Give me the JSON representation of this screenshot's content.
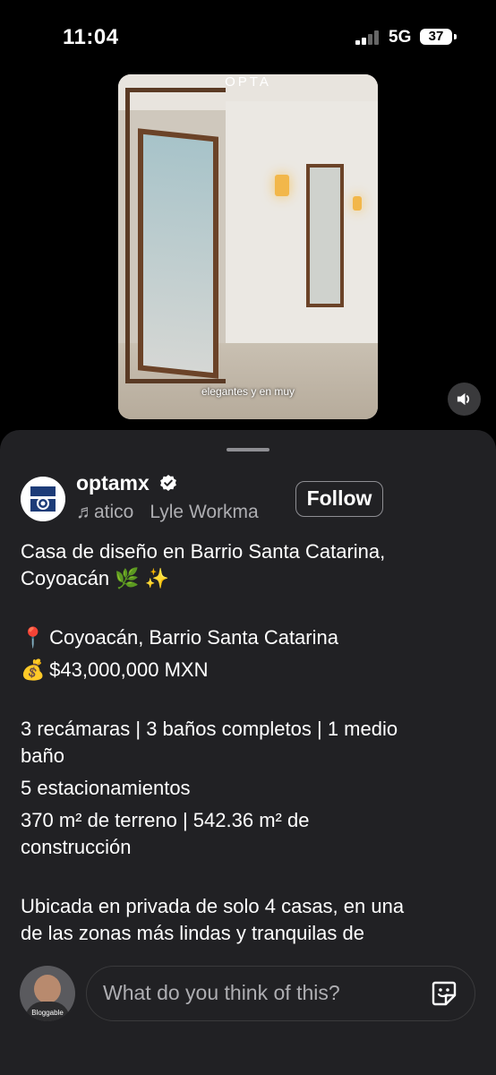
{
  "status": {
    "time": "11:04",
    "network": "5G",
    "battery": "37"
  },
  "video": {
    "brand": "OPTA",
    "caption": "elegantes y en muy",
    "mute_icon": "speaker-icon"
  },
  "post": {
    "username": "optamx",
    "verified_icon": "verified-badge-icon",
    "music_icon": "music-note-icon",
    "audio_track": "atico",
    "audio_artist": "Lyle Workma",
    "follow_label": "Follow",
    "description": {
      "title_line1": "Casa de diseño en Barrio Santa Catarina,",
      "title_line2": "Coyoacán 🌿 ✨",
      "location_emoji": "📍",
      "location": "Coyoacán, Barrio Santa Catarina",
      "price_emoji": "💰",
      "price": "$43,000,000 MXN",
      "rooms_line1": "3 recámaras | 3 baños completos | 1 medio",
      "rooms_line2": "baño",
      "parking": "5 estacionamientos",
      "area_line1": "370 m² de terreno | 542.36 m² de",
      "area_line2": "construcción",
      "more_line1": "Ubicada en privada de solo 4 casas, en una",
      "more_line2": "de las zonas más lindas y tranquilas de"
    }
  },
  "composer": {
    "avatar_label": "Bloggable",
    "placeholder": "What do you think of this?",
    "sticker_icon": "sticker-icon"
  }
}
